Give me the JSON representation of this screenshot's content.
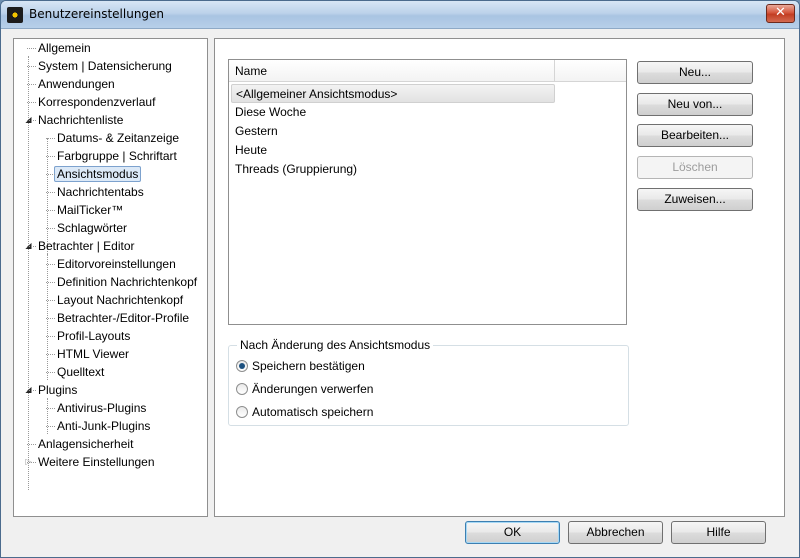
{
  "window": {
    "title": "Benutzereinstellungen",
    "close_glyph": "✕"
  },
  "tree": {
    "items": [
      {
        "label": "Allgemein",
        "level": 1
      },
      {
        "label": "System | Datensicherung",
        "level": 1
      },
      {
        "label": "Anwendungen",
        "level": 1
      },
      {
        "label": "Korrespondenzverlauf",
        "level": 1
      },
      {
        "label": "Nachrichtenliste",
        "level": 1,
        "expander": "open"
      },
      {
        "label": "Datums- & Zeitanzeige",
        "level": 2
      },
      {
        "label": "Farbgruppe | Schriftart",
        "level": 2
      },
      {
        "label": "Ansichtsmodus",
        "level": 2,
        "selected": true
      },
      {
        "label": "Nachrichtentabs",
        "level": 2
      },
      {
        "label": "MailTicker™",
        "level": 2
      },
      {
        "label": "Schlagwörter",
        "level": 2
      },
      {
        "label": "Betrachter | Editor",
        "level": 1,
        "expander": "open"
      },
      {
        "label": "Editorvoreinstellungen",
        "level": 2
      },
      {
        "label": "Definition Nachrichtenkopf",
        "level": 2
      },
      {
        "label": "Layout Nachrichtenkopf",
        "level": 2
      },
      {
        "label": "Betrachter-/Editor-Profile",
        "level": 2
      },
      {
        "label": "Profil-Layouts",
        "level": 2
      },
      {
        "label": "HTML Viewer",
        "level": 2
      },
      {
        "label": "Quelltext",
        "level": 2
      },
      {
        "label": "Plugins",
        "level": 1,
        "expander": "open"
      },
      {
        "label": "Antivirus-Plugins",
        "level": 2
      },
      {
        "label": "Anti-Junk-Plugins",
        "level": 2
      },
      {
        "label": "Anlagensicherheit",
        "level": 1
      },
      {
        "label": "Weitere Einstellungen",
        "level": 1,
        "expander": "closed"
      }
    ]
  },
  "list": {
    "header_name": "Name",
    "rows": [
      "<Allgemeiner Ansichtsmodus>",
      "Diese Woche",
      "Gestern",
      "Heute",
      "Threads (Gruppierung)"
    ]
  },
  "side_buttons": {
    "neu": "Neu...",
    "neu_von": "Neu von...",
    "bearbeiten": "Bearbeiten...",
    "loeschen": "Löschen",
    "zuweisen": "Zuweisen..."
  },
  "group": {
    "label": "Nach Änderung des Ansichtsmodus",
    "options": [
      {
        "label": "Speichern bestätigen",
        "checked": true
      },
      {
        "label": "Änderungen verwerfen",
        "checked": false
      },
      {
        "label": "Automatisch speichern",
        "checked": false
      }
    ]
  },
  "footer": {
    "ok": "OK",
    "cancel": "Abbrechen",
    "help": "Hilfe"
  }
}
